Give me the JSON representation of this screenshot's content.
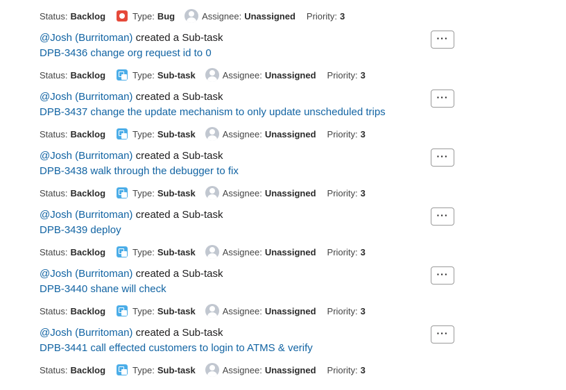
{
  "labels": {
    "status": "Status:",
    "type": "Type:",
    "assignee": "Assignee:",
    "priority": "Priority:",
    "created": "created a Sub-task",
    "more": "···"
  },
  "top_meta": {
    "status": "Backlog",
    "type": "Bug",
    "type_icon": "bug-icon",
    "assignee": "Unassigned",
    "priority": "3"
  },
  "items": [
    {
      "actor": "@Josh (Burritoman)",
      "issue": "DPB-3436 change org request id to 0",
      "status": "Backlog",
      "type": "Sub-task",
      "type_icon": "subtask-icon",
      "assignee": "Unassigned",
      "priority": "3"
    },
    {
      "actor": "@Josh (Burritoman)",
      "issue": "DPB-3437 change the update mechanism to only update unscheduled trips",
      "status": "Backlog",
      "type": "Sub-task",
      "type_icon": "subtask-icon",
      "assignee": "Unassigned",
      "priority": "3"
    },
    {
      "actor": "@Josh (Burritoman)",
      "issue": "DPB-3438 walk through the debugger to fix",
      "status": "Backlog",
      "type": "Sub-task",
      "type_icon": "subtask-icon",
      "assignee": "Unassigned",
      "priority": "3"
    },
    {
      "actor": "@Josh (Burritoman)",
      "issue": "DPB-3439 deploy",
      "status": "Backlog",
      "type": "Sub-task",
      "type_icon": "subtask-icon",
      "assignee": "Unassigned",
      "priority": "3"
    },
    {
      "actor": "@Josh (Burritoman)",
      "issue": "DPB-3440 shane will check",
      "status": "Backlog",
      "type": "Sub-task",
      "type_icon": "subtask-icon",
      "assignee": "Unassigned",
      "priority": "3"
    },
    {
      "actor": "@Josh (Burritoman)",
      "issue": "DPB-3441 call effected customers to login to ATMS & verify",
      "status": "Backlog",
      "type": "Sub-task",
      "type_icon": "subtask-icon",
      "assignee": "Unassigned",
      "priority": "3"
    }
  ]
}
